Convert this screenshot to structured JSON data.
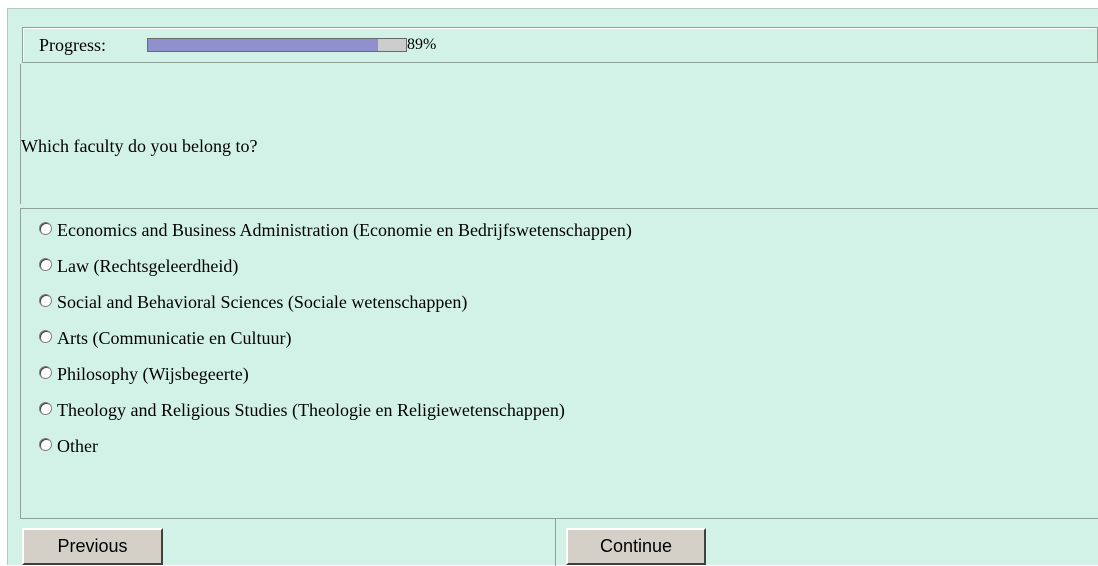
{
  "progress": {
    "label": "Progress:",
    "percent_text": "89%",
    "fraction": 0.89,
    "fill_color": "#9090cc",
    "track_color": "#cccccc"
  },
  "question": {
    "text": "Which faculty do you belong to?"
  },
  "options": [
    {
      "label": "Economics and Business Administration (Economie en Bedrijfswetenschappen)",
      "selected": false
    },
    {
      "label": "Law (Rechtsgeleerdheid)",
      "selected": false
    },
    {
      "label": "Social and Behavioral Sciences (Sociale wetenschappen)",
      "selected": false
    },
    {
      "label": "Arts (Communicatie en Cultuur)",
      "selected": false
    },
    {
      "label": "Philosophy (Wijsbegeerte)",
      "selected": false
    },
    {
      "label": "Theology and Religious Studies (Theologie en Religiewetenschappen)",
      "selected": false
    },
    {
      "label": "Other",
      "selected": false
    }
  ],
  "navigation": {
    "previous_label": "Previous",
    "continue_label": "Continue"
  },
  "colors": {
    "page_background": "#d2f2e8",
    "button_face": "#d4d0c8"
  },
  "icons": {
    "radio": "radio-button-icon"
  }
}
